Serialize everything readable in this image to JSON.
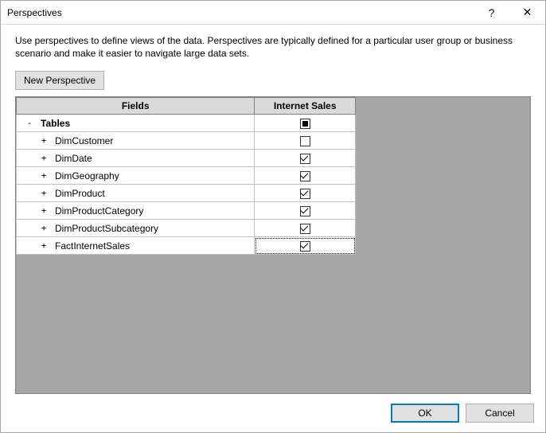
{
  "titlebar": {
    "title": "Perspectives",
    "help": "?",
    "close": "✕"
  },
  "description": "Use perspectives to define views of the data. Perspectives are typically defined for a particular user group or business scenario and make it easier to navigate large data sets.",
  "newPerspectiveLabel": "New Perspective",
  "columns": {
    "fields": "Fields",
    "perspective": "Internet Sales"
  },
  "rootRow": {
    "toggle": "-",
    "label": "Tables",
    "checkState": "square"
  },
  "rows": [
    {
      "toggle": "+",
      "label": "DimCustomer",
      "checkState": "unchecked"
    },
    {
      "toggle": "+",
      "label": "DimDate",
      "checkState": "checked"
    },
    {
      "toggle": "+",
      "label": "DimGeography",
      "checkState": "checked"
    },
    {
      "toggle": "+",
      "label": "DimProduct",
      "checkState": "checked"
    },
    {
      "toggle": "+",
      "label": "DimProductCategory",
      "checkState": "checked"
    },
    {
      "toggle": "+",
      "label": "DimProductSubcategory",
      "checkState": "checked"
    },
    {
      "toggle": "+",
      "label": "FactInternetSales",
      "checkState": "checked",
      "focused": true
    }
  ],
  "buttons": {
    "ok": "OK",
    "cancel": "Cancel"
  }
}
